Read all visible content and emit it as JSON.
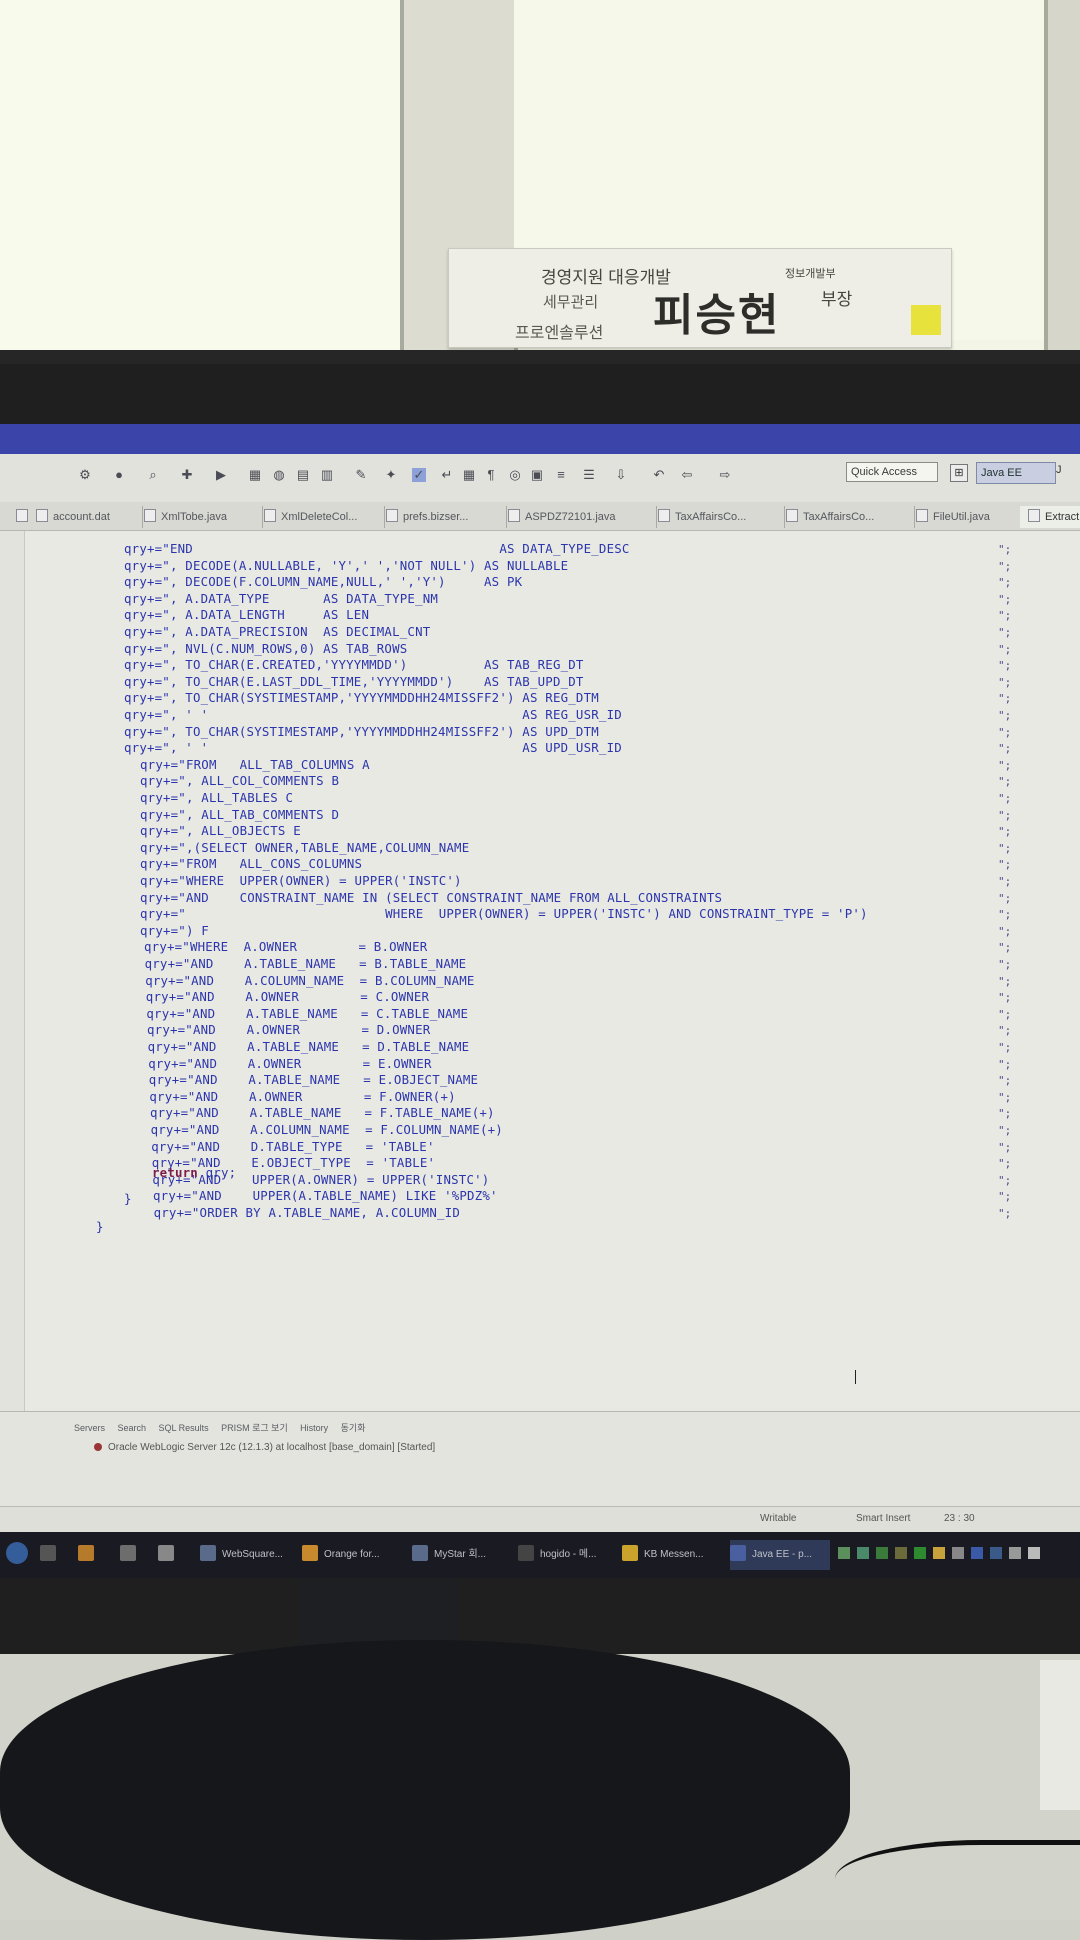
{
  "nameplate": {
    "department": "경영지원 대응개발",
    "department_small": "정보개발부",
    "role": "세무관리",
    "team": "프로엔솔루션",
    "name": "피승현",
    "rank": "부장"
  },
  "toolbar": {
    "quick_access_placeholder": "Quick Access",
    "perspective_open_icon": "open-perspective-icon",
    "perspective_javaee": "Java EE",
    "perspective_extra": "J"
  },
  "tabs": [
    {
      "label": "account.dat"
    },
    {
      "label": "XmlTobe.java"
    },
    {
      "label": "XmlDeleteCol..."
    },
    {
      "label": "prefs.bizser..."
    },
    {
      "label": "ASPDZ72101.java"
    },
    {
      "label": "TaxAffairsCo..."
    },
    {
      "label": "TaxAffairsCo..."
    },
    {
      "label": "FileUtil.java"
    },
    {
      "label": "Extract"
    }
  ],
  "code_lines": [
    "qry+=\"END                                        AS DATA_TYPE_DESC",
    "qry+=\", DECODE(A.NULLABLE, 'Y',' ','NOT NULL') AS NULLABLE",
    "qry+=\", DECODE(F.COLUMN_NAME,NULL,' ','Y')     AS PK",
    "qry+=\", A.DATA_TYPE       AS DATA_TYPE_NM",
    "qry+=\", A.DATA_LENGTH     AS LEN",
    "qry+=\", A.DATA_PRECISION  AS DECIMAL_CNT",
    "qry+=\", NVL(C.NUM_ROWS,0) AS TAB_ROWS",
    "qry+=\", TO_CHAR(E.CREATED,'YYYYMMDD')          AS TAB_REG_DT",
    "qry+=\", TO_CHAR(E.LAST_DDL_TIME,'YYYYMMDD')    AS TAB_UPD_DT",
    "qry+=\", TO_CHAR(SYSTIMESTAMP,'YYYYMMDDHH24MISSFF2') AS REG_DTM",
    "qry+=\", ' '                                         AS REG_USR_ID",
    "qry+=\", TO_CHAR(SYSTIMESTAMP,'YYYYMMDDHH24MISSFF2') AS UPD_DTM",
    "qry+=\", ' '                                         AS UPD_USR_ID",
    "qry+=\"FROM   ALL_TAB_COLUMNS A",
    "qry+=\", ALL_COL_COMMENTS B",
    "qry+=\", ALL_TABLES C",
    "qry+=\", ALL_TAB_COMMENTS D",
    "qry+=\", ALL_OBJECTS E",
    "qry+=\",(SELECT OWNER,TABLE_NAME,COLUMN_NAME",
    "qry+=\"FROM   ALL_CONS_COLUMNS",
    "qry+=\"WHERE  UPPER(OWNER) = UPPER('INSTC')",
    "qry+=\"AND    CONSTRAINT_NAME IN (SELECT CONSTRAINT_NAME FROM ALL_CONSTRAINTS",
    "qry+=\"                          WHERE  UPPER(OWNER) = UPPER('INSTC') AND CONSTRAINT_TYPE = 'P')",
    "qry+=\") F",
    "qry+=\"WHERE  A.OWNER        = B.OWNER",
    "qry+=\"AND    A.TABLE_NAME   = B.TABLE_NAME",
    "qry+=\"AND    A.COLUMN_NAME  = B.COLUMN_NAME",
    "qry+=\"AND    A.OWNER        = C.OWNER",
    "qry+=\"AND    A.TABLE_NAME   = C.TABLE_NAME",
    "qry+=\"AND    A.OWNER        = D.OWNER",
    "qry+=\"AND    A.TABLE_NAME   = D.TABLE_NAME",
    "qry+=\"AND    A.OWNER        = E.OWNER",
    "qry+=\"AND    A.TABLE_NAME   = E.OBJECT_NAME",
    "qry+=\"AND    A.OWNER        = F.OWNER(+)",
    "qry+=\"AND    A.TABLE_NAME   = F.TABLE_NAME(+)",
    "qry+=\"AND    A.COLUMN_NAME  = F.COLUMN_NAME(+)",
    "qry+=\"AND    D.TABLE_TYPE   = 'TABLE'",
    "qry+=\"AND    E.OBJECT_TYPE  = 'TABLE'",
    "qry+=\"AND    UPPER(A.OWNER) = UPPER('INSTC')",
    "qry+=\"AND    UPPER(A.TABLE_NAME) LIKE '%PDZ%'",
    "qry+=\"ORDER BY A.TABLE_NAME, A.COLUMN_ID"
  ],
  "return_keyword": "return",
  "return_expr": " qry;",
  "close_brace_1": "}",
  "close_brace_2": "}",
  "bottom_panel": {
    "tabs": [
      "Servers",
      "Search",
      "SQL Results",
      "PRISM 로그 보기",
      "History",
      "동기화"
    ],
    "server_row": "Oracle WebLogic Server 12c (12.1.3) at localhost [base_domain]  [Started]"
  },
  "status_bar": {
    "writable": "Writable",
    "insert_mode": "Smart Insert",
    "position": "23 : 30"
  },
  "taskbar": {
    "buttons": [
      {
        "label": "WebSquare..."
      },
      {
        "label": "Orange for..."
      },
      {
        "label": "MyStar 회..."
      },
      {
        "label": "hogido - 메..."
      },
      {
        "label": "KB Messen..."
      },
      {
        "label": "Java EE - p..."
      }
    ]
  },
  "colors": {
    "code_text": "#2c35ad",
    "keyword": "#7b1e4e",
    "title_strip": "#3b44a8",
    "editor_bg": "#e8e9e2"
  }
}
